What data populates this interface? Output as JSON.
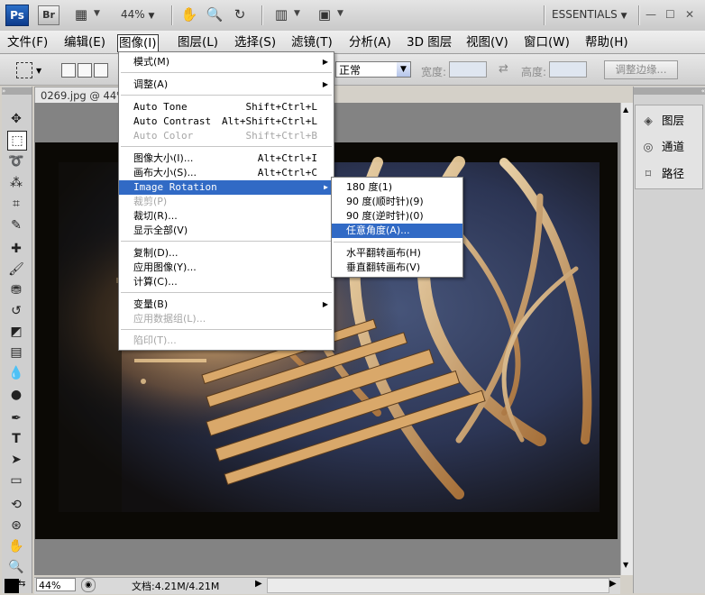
{
  "app": {
    "logo": "Ps",
    "bridge": "Br",
    "zoom": "44%",
    "workspace": "ESSENTIALS"
  },
  "menubar": [
    "文件(F)",
    "编辑(E)",
    "图像(I)",
    "图层(L)",
    "选择(S)",
    "滤镜(T)",
    "分析(A)",
    "3D 图层",
    "视图(V)",
    "窗口(W)",
    "帮助(H)"
  ],
  "options": {
    "blend_mode": "正常",
    "width_label": "宽度:",
    "height_label": "高度:",
    "refine_edge": "调整边缘..."
  },
  "document": {
    "tab_title": "0269.jpg @ 44%",
    "status_zoom": "44%",
    "info": "文档:4.21M/4.21M"
  },
  "panels": [
    {
      "label": "图层",
      "icon": "layers-icon"
    },
    {
      "label": "通道",
      "icon": "channels-icon"
    },
    {
      "label": "路径",
      "icon": "paths-icon"
    }
  ],
  "image_menu": {
    "mode": "模式(M)",
    "adjust": "调整(A)",
    "auto_tone": "Auto Tone",
    "auto_tone_sc": "Shift+Ctrl+L",
    "auto_contrast": "Auto Contrast",
    "auto_contrast_sc": "Alt+Shift+Ctrl+L",
    "auto_color": "Auto Color",
    "auto_color_sc": "Shift+Ctrl+B",
    "image_size": "图像大小(I)...",
    "image_size_sc": "Alt+Ctrl+I",
    "canvas_size": "画布大小(S)...",
    "canvas_size_sc": "Alt+Ctrl+C",
    "rotation": "Image Rotation",
    "crop": "裁剪(P)",
    "trim": "裁切(R)...",
    "reveal_all": "显示全部(V)",
    "duplicate": "复制(D)...",
    "apply_image": "应用图像(Y)...",
    "calculations": "计算(C)...",
    "variables": "变量(B)",
    "apply_dataset": "应用数据组(L)...",
    "trap": "陷印(T)..."
  },
  "rotation_menu": {
    "r180": "180 度(1)",
    "r90cw": "90 度(顺时针)(9)",
    "r90ccw": "90 度(逆时针)(0)",
    "arbitrary": "任意角度(A)...",
    "flip_h": "水平翻转画布(H)",
    "flip_v": "垂直翻转画布(V)"
  }
}
